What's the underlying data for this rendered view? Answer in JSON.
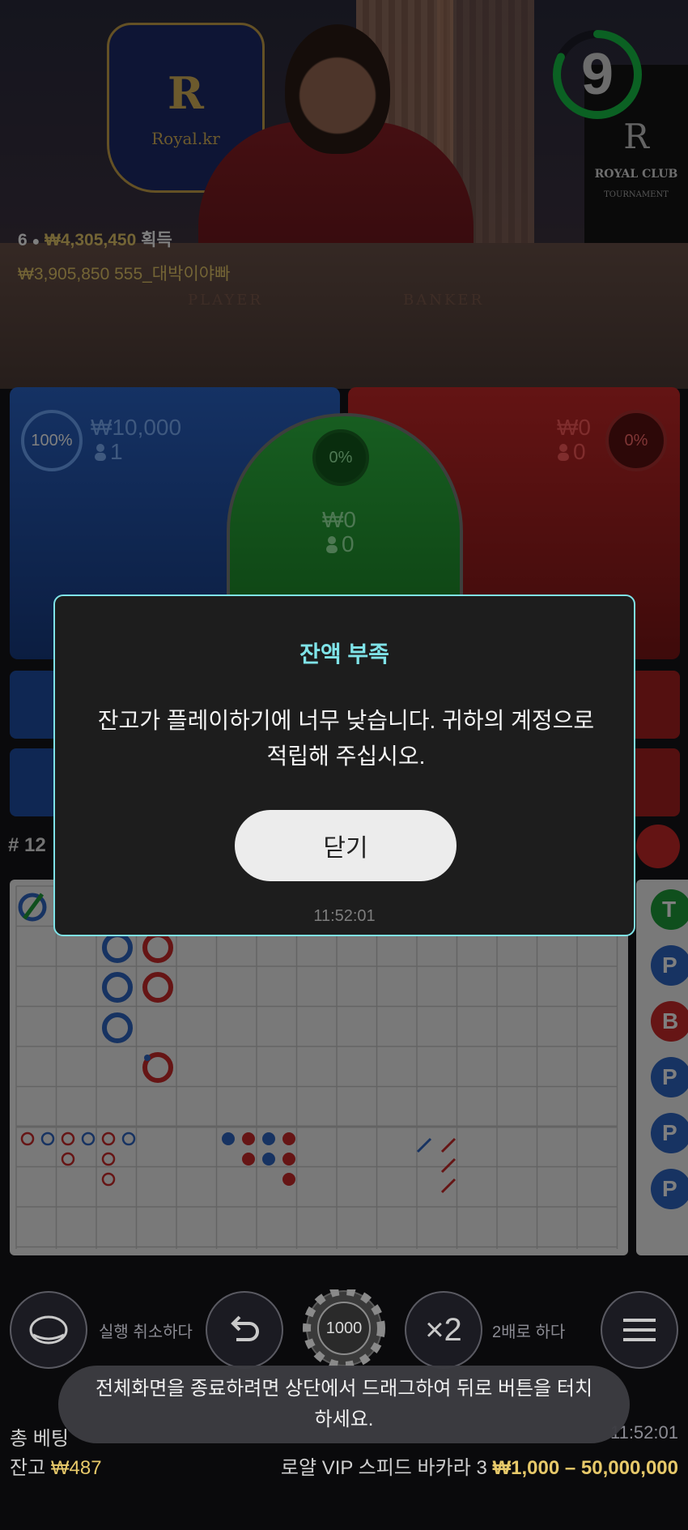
{
  "video": {
    "brand_logo_text": "Royal.kr",
    "brand_logo_letter": "R",
    "club_letter": "R",
    "club_name": "ROYAL CLUB",
    "club_sub": "TOURNAMENT",
    "table_player_word": "PLAYER",
    "table_banker_word": "BANKER",
    "countdown": "9",
    "countdown_fraction": 0.82
  },
  "winners": {
    "count": "6",
    "total": "₩4,305,450",
    "total_suffix": "획득",
    "top_amount": "₩3,905,850",
    "top_name": "555_대박이야빠"
  },
  "bets": {
    "player": {
      "percent": "100%",
      "amount": "₩10,000",
      "players": "1"
    },
    "tie": {
      "percent": "0%",
      "amount": "₩0",
      "players": "0"
    },
    "banker": {
      "percent": "0%",
      "amount": "₩0",
      "players": "0"
    }
  },
  "roadmap": {
    "round_label": "# 12",
    "right_beads": [
      "T",
      "P",
      "B",
      "P",
      "P",
      "P"
    ]
  },
  "modal": {
    "title": "잔액 부족",
    "message": "잔고가 플레이하기에 너무 낮습니다. 귀하의 계정으로 적립해 주십시오.",
    "close_label": "닫기",
    "time": "11:52:01"
  },
  "controls": {
    "undo_label": "실행 취소하다",
    "chip_value": "1000",
    "double_symbol": "×2",
    "double_label": "2배로 하다"
  },
  "toast": {
    "text": "전체화면을 종료하려면 상단에서 드래그하여 뒤로 버튼을 터치하세요."
  },
  "footer": {
    "total_bet_label": "총 베팅",
    "time": "11:52:01",
    "balance_label": "잔고",
    "balance_value": "₩487",
    "table_name": "로얄 VIP 스피드 바카라 3",
    "limits": "₩1,000 – 50,000,000"
  },
  "colors": {
    "accent": "#7fe3e8",
    "gold": "#e7c96a",
    "player": "#2a64c8",
    "banker": "#c82828",
    "tie": "#2fbb42"
  }
}
